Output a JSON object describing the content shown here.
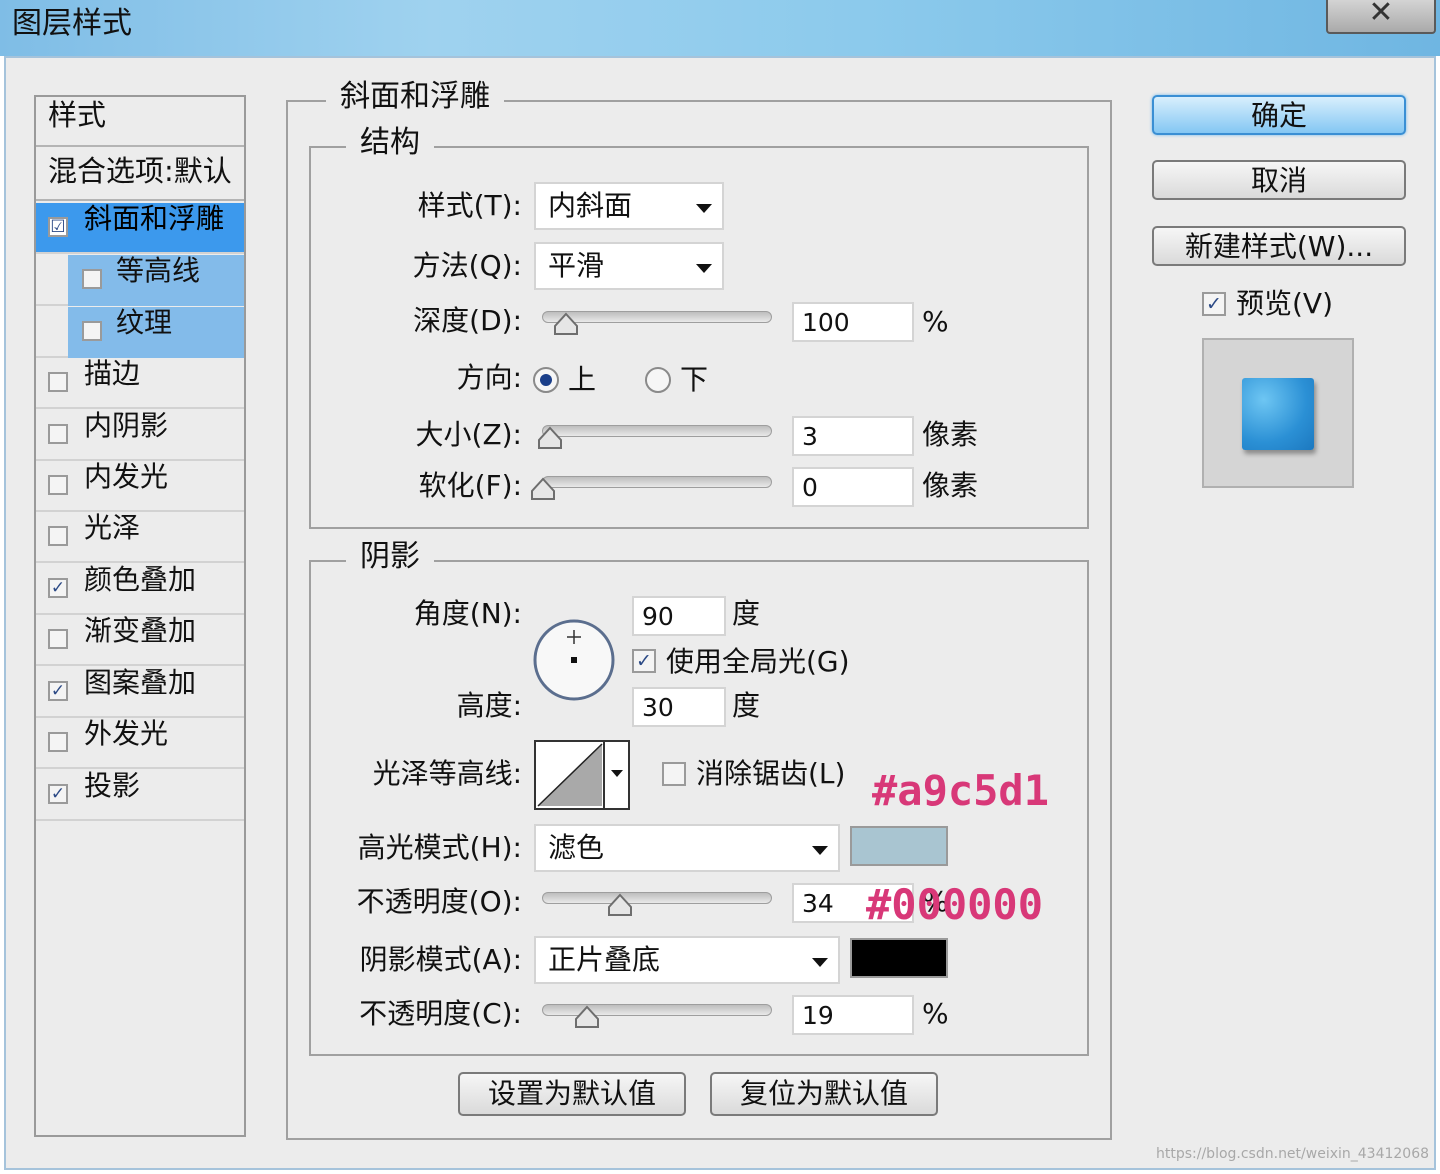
{
  "window": {
    "title": "图层样式",
    "close_label": "✕"
  },
  "style_list": {
    "header": "样式",
    "blend_options": "混合选项:默认",
    "items": [
      {
        "label": "斜面和浮雕",
        "checked": "☑"
      },
      {
        "label": "等高线",
        "checked": ""
      },
      {
        "label": "纹理",
        "checked": ""
      },
      {
        "label": "描边",
        "checked": ""
      },
      {
        "label": "内阴影",
        "checked": ""
      },
      {
        "label": "内发光",
        "checked": ""
      },
      {
        "label": "光泽",
        "checked": ""
      },
      {
        "label": "颜色叠加",
        "checked": "✓"
      },
      {
        "label": "渐变叠加",
        "checked": ""
      },
      {
        "label": "图案叠加",
        "checked": "✓"
      },
      {
        "label": "外发光",
        "checked": ""
      },
      {
        "label": "投影",
        "checked": "✓"
      }
    ]
  },
  "bevel": {
    "section_title": "斜面和浮雕",
    "structure": {
      "title": "结构",
      "style_label": "样式(T):",
      "style_value": "内斜面",
      "method_label": "方法(Q):",
      "method_value": "平滑",
      "depth_label": "深度(D):",
      "depth_value": "100",
      "depth_unit": "%",
      "depth_level": 0.1,
      "direction_label": "方向:",
      "direction_up": "上",
      "direction_down": "下",
      "size_label": "大小(Z):",
      "size_value": "3",
      "size_unit": "像素",
      "soften_label": "软化(F):",
      "soften_value": "0",
      "soften_unit": "像素"
    },
    "shading": {
      "title": "阴影",
      "angle_label": "角度(N):",
      "angle_value": "90",
      "angle_unit": "度",
      "global_light_label": "使用全局光(G)",
      "altitude_label": "高度:",
      "altitude_value": "30",
      "altitude_unit": "度",
      "gloss_contour_label": "光泽等高线:",
      "antialias_label": "消除锯齿(L)",
      "highlight_mode_label": "高光模式(H):",
      "highlight_mode_value": "滤色",
      "highlight_color": "#a9c5d1",
      "highlight_opacity_label": "不透明度(O):",
      "highlight_opacity_value": "34",
      "shadow_mode_label": "阴影模式(A):",
      "shadow_mode_value": "正片叠底",
      "shadow_color": "#000000",
      "shadow_opacity_label": "不透明度(C):",
      "shadow_opacity_value": "19",
      "percent": "%"
    },
    "make_default": "设置为默认值",
    "reset_default": "复位为默认值"
  },
  "actions": {
    "ok": "确定",
    "cancel": "取消",
    "new_style": "新建样式(W)...",
    "preview_label": "预览(V)"
  },
  "annotations": {
    "highlight_hex": "#a9c5d1",
    "shadow_hex": "#000000"
  },
  "watermark": "https://blog.csdn.net/weixin_43412068"
}
